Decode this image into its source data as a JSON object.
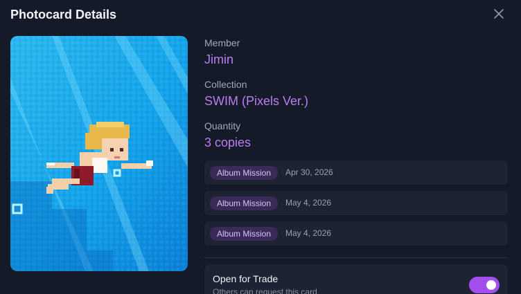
{
  "dialog": {
    "title": "Photocard Details"
  },
  "icons": {
    "close": "close-icon"
  },
  "photocard": {
    "image_alt": "pixel-art swimmer",
    "member_label": "Member",
    "member": "Jimin",
    "collection_label": "Collection",
    "collection": "SWIM (Pixels Ver.)",
    "quantity_label": "Quantity",
    "quantity": "3 copies"
  },
  "acquisitions": [
    {
      "source": "Album Mission",
      "date": "Apr 30, 2026"
    },
    {
      "source": "Album Mission",
      "date": "May 4, 2026"
    },
    {
      "source": "Album Mission",
      "date": "May 4, 2026"
    }
  ],
  "trade": {
    "title": "Open for Trade",
    "subtitle": "Others can request this card",
    "enabled": true
  },
  "colors": {
    "accent": "#a44ef0",
    "value_text": "#bb7df2",
    "background": "#151a28"
  }
}
